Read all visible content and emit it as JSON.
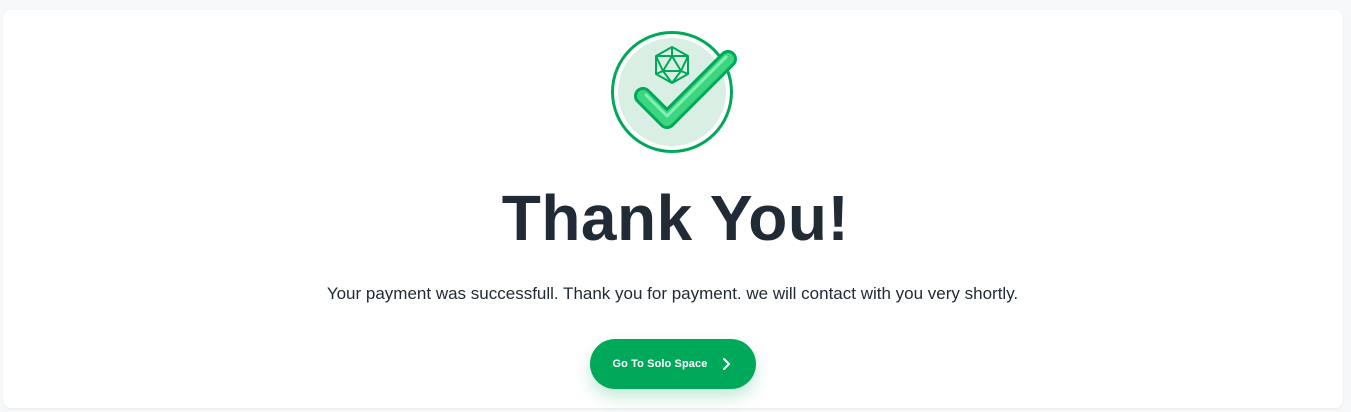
{
  "colors": {
    "accent": "#00a85a",
    "badge_fill": "#d9efe3",
    "check_light": "#3dd680",
    "text_dark": "#212b36",
    "page_bg": "#f6f8fa",
    "card_bg": "#ffffff"
  },
  "icons": {
    "badge": "check-badge-icon",
    "dice": "d20-dice-icon",
    "button": "chevron-right-icon"
  },
  "confirmation": {
    "title": "Thank You!",
    "message": "Your payment was successfull. Thank you for payment. we will contact with you very shortly.",
    "button_label": "Go To Solo Space"
  }
}
